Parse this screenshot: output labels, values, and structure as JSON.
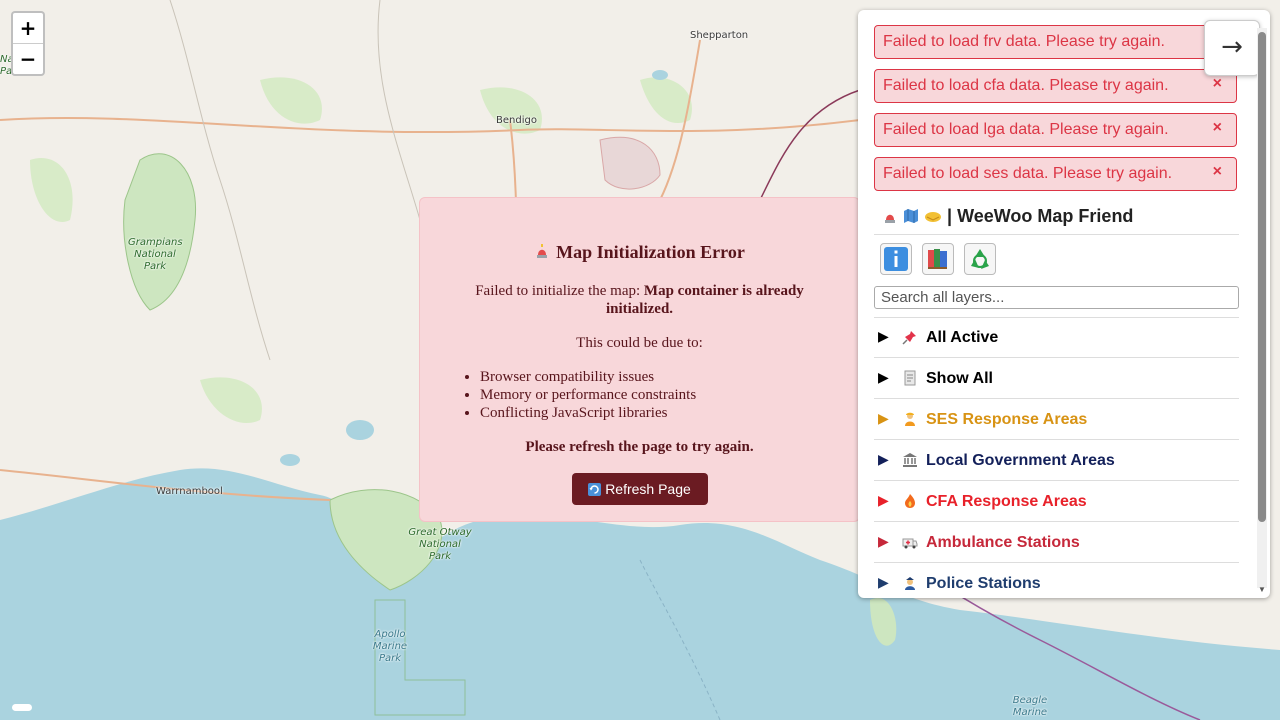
{
  "map": {
    "places": {
      "shepparton": "Shepparton",
      "bendigo": "Bendigo",
      "warrnambool": "Warrnambool",
      "grampians": "Grampians\nNational\nPark",
      "great_otway": "Great Otway\nNational\nPark",
      "apollo": "Apollo\nMarine\nPark",
      "beagle": "Beagle\nMarine",
      "left_park": "National\nPark"
    },
    "zoom_in": "+",
    "zoom_out": "−"
  },
  "error_modal": {
    "icon": "siren-icon",
    "title": "Map Initialization Error",
    "message_prefix": "Failed to initialize the map:",
    "message_bold": "Map container is already initialized.",
    "could_be": "This could be due to:",
    "reasons": [
      "Browser compatibility issues",
      "Memory or performance constraints",
      "Conflicting JavaScript libraries"
    ],
    "refresh_hint": "Please refresh the page to try again.",
    "refresh_button": "Refresh Page"
  },
  "sidebar": {
    "toasts": [
      {
        "text": "Failed to load frv data. Please try again.",
        "close": "×"
      },
      {
        "text": "Failed to load cfa data. Please try again.",
        "close": "×"
      },
      {
        "text": "Failed to load lga data. Please try again.",
        "close": "×"
      },
      {
        "text": "Failed to load ses data. Please try again.",
        "close": "×"
      }
    ],
    "collapse_arrow": "→",
    "title": "| WeeWoo Map Friend",
    "search_placeholder": "Search all layers...",
    "categories": [
      {
        "label": "All Active",
        "icon": "pin-icon",
        "color": "#000000",
        "tri_color": "#000000"
      },
      {
        "label": "Show All",
        "icon": "list-icon",
        "color": "#000000",
        "tri_color": "#000000"
      },
      {
        "label": "SES Response Areas",
        "icon": "worker-icon",
        "color": "#d89314",
        "tri_color": "#d89314"
      },
      {
        "label": "Local Government Areas",
        "icon": "building-icon",
        "color": "#13205a",
        "tri_color": "#13205a"
      },
      {
        "label": "CFA Response Areas",
        "icon": "fire-icon",
        "color": "#e8212a",
        "tri_color": "#e8212a"
      },
      {
        "label": "Ambulance Stations",
        "icon": "ambulance-icon",
        "color": "#c6283a",
        "tri_color": "#c6283a"
      },
      {
        "label": "Police Stations",
        "icon": "police-icon",
        "color": "#1f3d6e",
        "tri_color": "#1f3d6e"
      }
    ]
  }
}
